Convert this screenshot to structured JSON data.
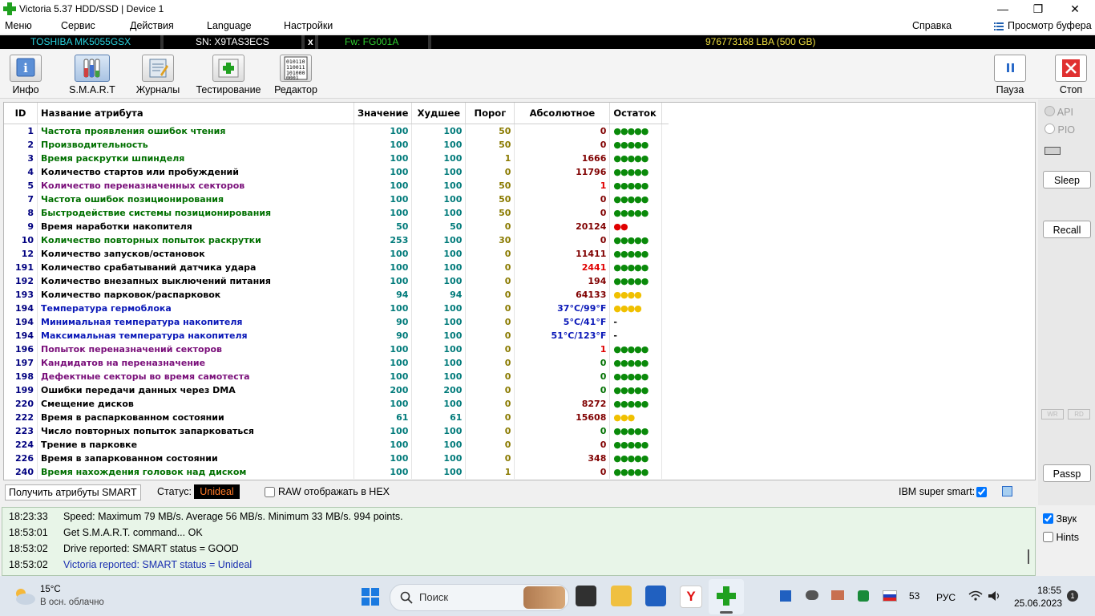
{
  "window": {
    "title": "Victoria 5.37 HDD/SSD | Device 1"
  },
  "menu": {
    "items": [
      "Меню",
      "Сервис",
      "Действия",
      "Language",
      "Настройки"
    ],
    "help": "Справка",
    "buffer": "Просмотр буфера"
  },
  "drive": {
    "model": "TOSHIBA MK5055GSX",
    "serial": "SN: X9TAS3ECS",
    "close": "x",
    "firmware": "Fw: FG001A",
    "lba": "976773168 LBA (500 GB)"
  },
  "toolbar": {
    "info": "Инфо",
    "smart": "S.M.A.R.T",
    "logs": "Журналы",
    "test": "Тестирование",
    "editor": "Редактор",
    "pause": "Пауза",
    "stop": "Стоп"
  },
  "table": {
    "headers": {
      "id": "ID",
      "name": "Название атрибута",
      "value": "Значение",
      "worst": "Худшее",
      "threshold": "Порог",
      "absolute": "Абсолютное",
      "remaining": "Остаток"
    },
    "rows": [
      {
        "id": "1",
        "name": "Частота проявления ошибок чтения",
        "nc": "green",
        "val": "100",
        "worst": "100",
        "thr": "50",
        "thrc": "olive",
        "abs": "0",
        "absc": "darkred",
        "rem": "●●●●●",
        "remc": "g"
      },
      {
        "id": "2",
        "name": "Производительность",
        "nc": "green",
        "val": "100",
        "worst": "100",
        "thr": "50",
        "thrc": "olive",
        "abs": "0",
        "absc": "darkred",
        "rem": "●●●●●",
        "remc": "g"
      },
      {
        "id": "3",
        "name": "Время раскрутки шпинделя",
        "nc": "green",
        "val": "100",
        "worst": "100",
        "thr": "1",
        "thrc": "olive",
        "abs": "1666",
        "absc": "darkred",
        "rem": "●●●●●",
        "remc": "g"
      },
      {
        "id": "4",
        "name": "Количество стартов или пробуждений",
        "nc": "black",
        "val": "100",
        "worst": "100",
        "thr": "0",
        "thrc": "olive",
        "abs": "11796",
        "absc": "darkred",
        "rem": "●●●●●",
        "remc": "g"
      },
      {
        "id": "5",
        "name": "Количество переназначенных секторов",
        "nc": "purple",
        "val": "100",
        "worst": "100",
        "thr": "50",
        "thrc": "olive",
        "abs": "1",
        "absc": "red",
        "rem": "●●●●●",
        "remc": "g"
      },
      {
        "id": "7",
        "name": "Частота ошибок позиционирования",
        "nc": "green",
        "val": "100",
        "worst": "100",
        "thr": "50",
        "thrc": "olive",
        "abs": "0",
        "absc": "darkred",
        "rem": "●●●●●",
        "remc": "g"
      },
      {
        "id": "8",
        "name": "Быстродействие системы позиционирования",
        "nc": "green",
        "val": "100",
        "worst": "100",
        "thr": "50",
        "thrc": "olive",
        "abs": "0",
        "absc": "darkred",
        "rem": "●●●●●",
        "remc": "g"
      },
      {
        "id": "9",
        "name": "Время наработки накопителя",
        "nc": "black",
        "val": "50",
        "worst": "50",
        "thr": "0",
        "thrc": "olive",
        "abs": "20124",
        "absc": "darkred",
        "rem": "●●",
        "remc": "r"
      },
      {
        "id": "10",
        "name": "Количество повторных попыток раскрутки",
        "nc": "green",
        "val": "253",
        "worst": "100",
        "thr": "30",
        "thrc": "olive",
        "abs": "0",
        "absc": "darkred",
        "rem": "●●●●●",
        "remc": "g"
      },
      {
        "id": "12",
        "name": "Количество запусков/остановок",
        "nc": "black",
        "val": "100",
        "worst": "100",
        "thr": "0",
        "thrc": "olive",
        "abs": "11411",
        "absc": "darkred",
        "rem": "●●●●●",
        "remc": "g"
      },
      {
        "id": "191",
        "name": "Количество срабатываний датчика удара",
        "nc": "black",
        "val": "100",
        "worst": "100",
        "thr": "0",
        "thrc": "olive",
        "abs": "2441",
        "absc": "red",
        "rem": "●●●●●",
        "remc": "g"
      },
      {
        "id": "192",
        "name": "Количество внезапных выключений питания",
        "nc": "black",
        "val": "100",
        "worst": "100",
        "thr": "0",
        "thrc": "olive",
        "abs": "194",
        "absc": "darkred",
        "rem": "●●●●●",
        "remc": "g"
      },
      {
        "id": "193",
        "name": "Количество парковок/распарковок",
        "nc": "black",
        "val": "94",
        "worst": "94",
        "thr": "0",
        "thrc": "olive",
        "abs": "64133",
        "absc": "darkred",
        "rem": "●●●●",
        "remc": "y"
      },
      {
        "id": "194",
        "name": "Температура гермоблока",
        "nc": "blue",
        "val": "100",
        "worst": "100",
        "thr": "0",
        "thrc": "olive",
        "abs": "37°C/99°F",
        "absc": "blue",
        "rem": "●●●●",
        "remc": "y"
      },
      {
        "id": "194",
        "name": "Минимальная температура накопителя",
        "nc": "blue",
        "val": "90",
        "worst": "100",
        "thr": "0",
        "thrc": "olive",
        "abs": "5°C/41°F",
        "absc": "blue",
        "rem": "-",
        "remc": "k"
      },
      {
        "id": "194",
        "name": "Максимальная температура накопителя",
        "nc": "blue",
        "val": "90",
        "worst": "100",
        "thr": "0",
        "thrc": "olive",
        "abs": "51°C/123°F",
        "absc": "blue",
        "rem": "-",
        "remc": "k"
      },
      {
        "id": "196",
        "name": "Попыток переназначений секторов",
        "nc": "purple",
        "val": "100",
        "worst": "100",
        "thr": "0",
        "thrc": "olive",
        "abs": "1",
        "absc": "red",
        "rem": "●●●●●",
        "remc": "g"
      },
      {
        "id": "197",
        "name": "Кандидатов на переназначение",
        "nc": "purple",
        "val": "100",
        "worst": "100",
        "thr": "0",
        "thrc": "olive",
        "abs": "0",
        "absc": "green",
        "rem": "●●●●●",
        "remc": "g"
      },
      {
        "id": "198",
        "name": "Дефектные секторы во время самотеста",
        "nc": "purple",
        "val": "100",
        "worst": "100",
        "thr": "0",
        "thrc": "olive",
        "abs": "0",
        "absc": "green",
        "rem": "●●●●●",
        "remc": "g"
      },
      {
        "id": "199",
        "name": "Ошибки передачи данных через DMA",
        "nc": "black",
        "val": "200",
        "worst": "200",
        "thr": "0",
        "thrc": "olive",
        "abs": "0",
        "absc": "green",
        "rem": "●●●●●",
        "remc": "g"
      },
      {
        "id": "220",
        "name": "Смещение дисков",
        "nc": "black",
        "val": "100",
        "worst": "100",
        "thr": "0",
        "thrc": "olive",
        "abs": "8272",
        "absc": "darkred",
        "rem": "●●●●●",
        "remc": "g"
      },
      {
        "id": "222",
        "name": "Время в распаркованном состоянии",
        "nc": "black",
        "val": "61",
        "worst": "61",
        "thr": "0",
        "thrc": "olive",
        "abs": "15608",
        "absc": "darkred",
        "rem": "●●●",
        "remc": "y"
      },
      {
        "id": "223",
        "name": "Число повторных попыток запарковаться",
        "nc": "black",
        "val": "100",
        "worst": "100",
        "thr": "0",
        "thrc": "olive",
        "abs": "0",
        "absc": "green",
        "rem": "●●●●●",
        "remc": "g"
      },
      {
        "id": "224",
        "name": "Трение в парковке",
        "nc": "black",
        "val": "100",
        "worst": "100",
        "thr": "0",
        "thrc": "olive",
        "abs": "0",
        "absc": "darkred",
        "rem": "●●●●●",
        "remc": "g"
      },
      {
        "id": "226",
        "name": "Время в запаркованном состоянии",
        "nc": "black",
        "val": "100",
        "worst": "100",
        "thr": "0",
        "thrc": "olive",
        "abs": "348",
        "absc": "darkred",
        "rem": "●●●●●",
        "remc": "g"
      },
      {
        "id": "240",
        "name": "Время нахождения головок над диском",
        "nc": "green",
        "val": "100",
        "worst": "100",
        "thr": "1",
        "thrc": "olive",
        "abs": "0",
        "absc": "darkred",
        "rem": "●●●●●",
        "remc": "g"
      }
    ]
  },
  "status": {
    "get_button": "Получить атрибуты SMART",
    "label": "Статус:",
    "value": "Unideal",
    "raw_hex": "RAW отображать в HEX",
    "ibm": "IBM super smart:"
  },
  "sidepanel": {
    "api": "API",
    "pio": "PIO",
    "sleep": "Sleep",
    "recall": "Recall",
    "wr": "WR",
    "rd": "RD",
    "passp": "Passp",
    "sound": "Звук",
    "hints": "Hints"
  },
  "log": [
    {
      "time": "18:23:33",
      "text": "Speed: Maximum 79 MB/s. Average 56 MB/s. Minimum 33 MB/s. 994 points.",
      "color": "#000000"
    },
    {
      "time": "18:53:01",
      "text": "Get S.M.A.R.T. command... OK",
      "color": "#000000"
    },
    {
      "time": "18:53:02",
      "text": "Drive reported: SMART status = GOOD",
      "color": "#000000"
    },
    {
      "time": "18:53:02",
      "text": "Victoria reported: SMART status = Unideal",
      "color": "#1a2fb0"
    }
  ],
  "taskbar": {
    "weather_temp": "15°C",
    "weather_desc": "В осн. облачно",
    "search": "Поиск",
    "tray_num": "53",
    "lang": "РУС",
    "time": "18:55",
    "date": "25.06.2023",
    "notif": "1"
  }
}
